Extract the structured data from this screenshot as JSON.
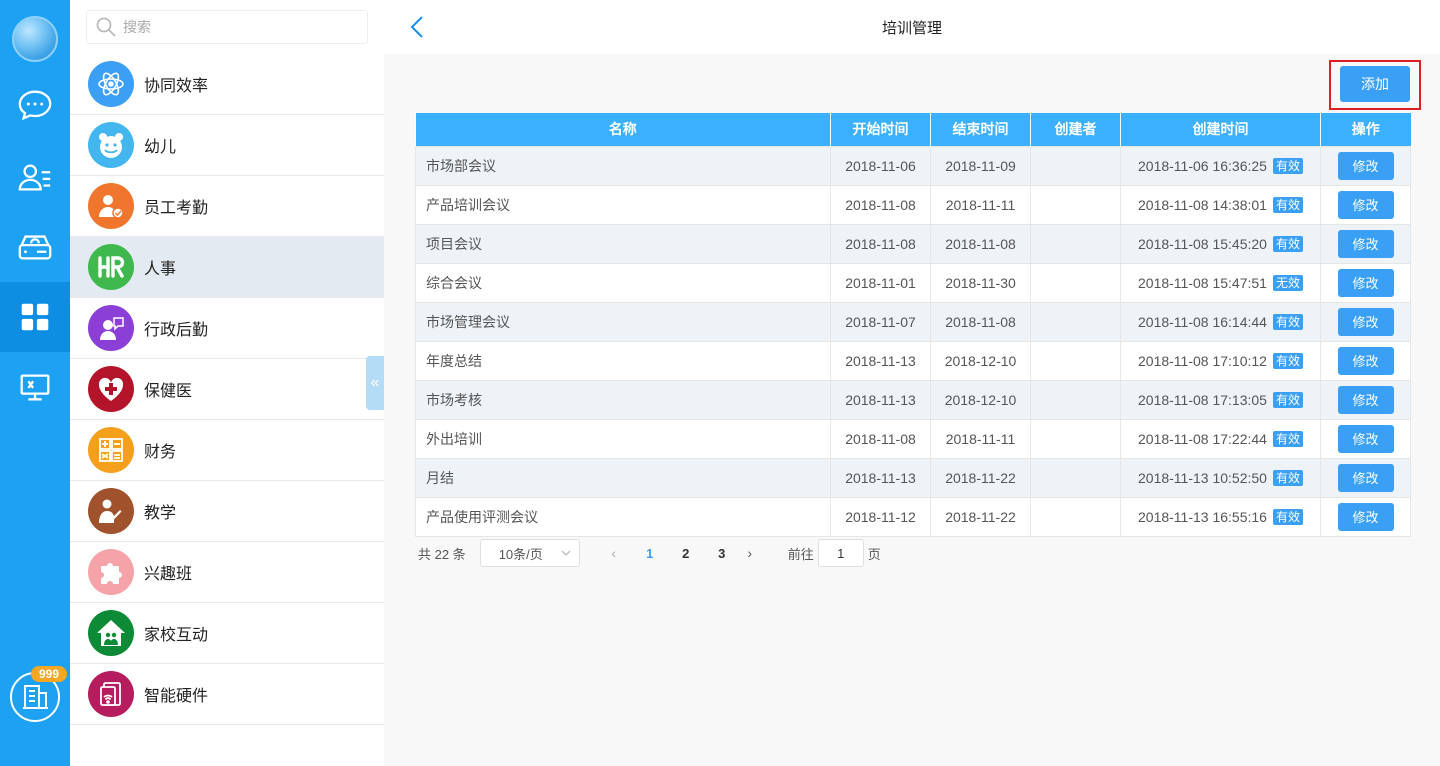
{
  "rail": {
    "badge": "999",
    "items": [
      {
        "icon": "chat-icon"
      },
      {
        "icon": "contacts-icon"
      },
      {
        "icon": "cloud-drive-icon"
      },
      {
        "icon": "apps-grid-icon"
      },
      {
        "icon": "monitor-icon"
      }
    ]
  },
  "sidebar": {
    "search_placeholder": "搜索",
    "items": [
      {
        "label": "协同效率",
        "icon": "atom-icon",
        "color": "#3a9ff5"
      },
      {
        "label": "幼儿",
        "icon": "smiley-face-icon",
        "color": "#43b6f0"
      },
      {
        "label": "员工考勤",
        "icon": "employee-attendance-icon",
        "color": "#f0762e"
      },
      {
        "label": "人事",
        "icon": "hr-icon",
        "color": "#3fb84e"
      },
      {
        "label": "行政后勤",
        "icon": "admin-logistics-icon",
        "color": "#8b3fd6"
      },
      {
        "label": "保健医",
        "icon": "heart-cross-icon",
        "color": "#b3142a"
      },
      {
        "label": "财务",
        "icon": "calculator-icon",
        "color": "#f5a01c"
      },
      {
        "label": "教学",
        "icon": "teacher-icon",
        "color": "#a0522d"
      },
      {
        "label": "兴趣班",
        "icon": "puzzle-icon",
        "color": "#f5a3a8"
      },
      {
        "label": "家校互动",
        "icon": "home-school-icon",
        "color": "#0d8a35"
      },
      {
        "label": "智能硬件",
        "icon": "smart-device-icon",
        "color": "#b51d5e"
      }
    ]
  },
  "header": {
    "title": "培训管理"
  },
  "toolbar": {
    "add_label": "添加"
  },
  "table": {
    "columns": [
      "名称",
      "开始时间",
      "结束时间",
      "创建者",
      "创建时间",
      "操作"
    ],
    "edit_label": "修改",
    "rows": [
      {
        "name": "市场部会议",
        "start": "2018-11-06",
        "end": "2018-11-09",
        "creator": "",
        "created": "2018-11-06 16:36:25",
        "status": "有效"
      },
      {
        "name": "产品培训会议",
        "start": "2018-11-08",
        "end": "2018-11-11",
        "creator": "",
        "created": "2018-11-08 14:38:01",
        "status": "有效"
      },
      {
        "name": "项目会议",
        "start": "2018-11-08",
        "end": "2018-11-08",
        "creator": "",
        "created": "2018-11-08 15:45:20",
        "status": "有效"
      },
      {
        "name": "综合会议",
        "start": "2018-11-01",
        "end": "2018-11-30",
        "creator": "",
        "created": "2018-11-08 15:47:51",
        "status": "无效"
      },
      {
        "name": "市场管理会议",
        "start": "2018-11-07",
        "end": "2018-11-08",
        "creator": "",
        "created": "2018-11-08 16:14:44",
        "status": "有效"
      },
      {
        "name": "年度总结",
        "start": "2018-11-13",
        "end": "2018-12-10",
        "creator": "",
        "created": "2018-11-08 17:10:12",
        "status": "有效"
      },
      {
        "name": "市场考核",
        "start": "2018-11-13",
        "end": "2018-12-10",
        "creator": "",
        "created": "2018-11-08 17:13:05",
        "status": "有效"
      },
      {
        "name": "外出培训",
        "start": "2018-11-08",
        "end": "2018-11-11",
        "creator": "",
        "created": "2018-11-08 17:22:44",
        "status": "有效"
      },
      {
        "name": "月结",
        "start": "2018-11-13",
        "end": "2018-11-22",
        "creator": "",
        "created": "2018-11-13 10:52:50",
        "status": "有效"
      },
      {
        "name": "产品使用评测会议",
        "start": "2018-11-12",
        "end": "2018-11-22",
        "creator": "",
        "created": "2018-11-13 16:55:16",
        "status": "有效"
      }
    ]
  },
  "pagination": {
    "total": "共 22 条",
    "page_size": "10条/页",
    "prev": "‹",
    "next": "›",
    "pages": [
      "1",
      "2",
      "3"
    ],
    "current": "1",
    "goto_prefix": "前往",
    "goto_value": "1",
    "goto_suffix": "页"
  },
  "colors": {
    "rail": "#1da1f2",
    "accent": "#3aa0f5",
    "header": "#3ab0ff",
    "highlight": "#e02020"
  }
}
